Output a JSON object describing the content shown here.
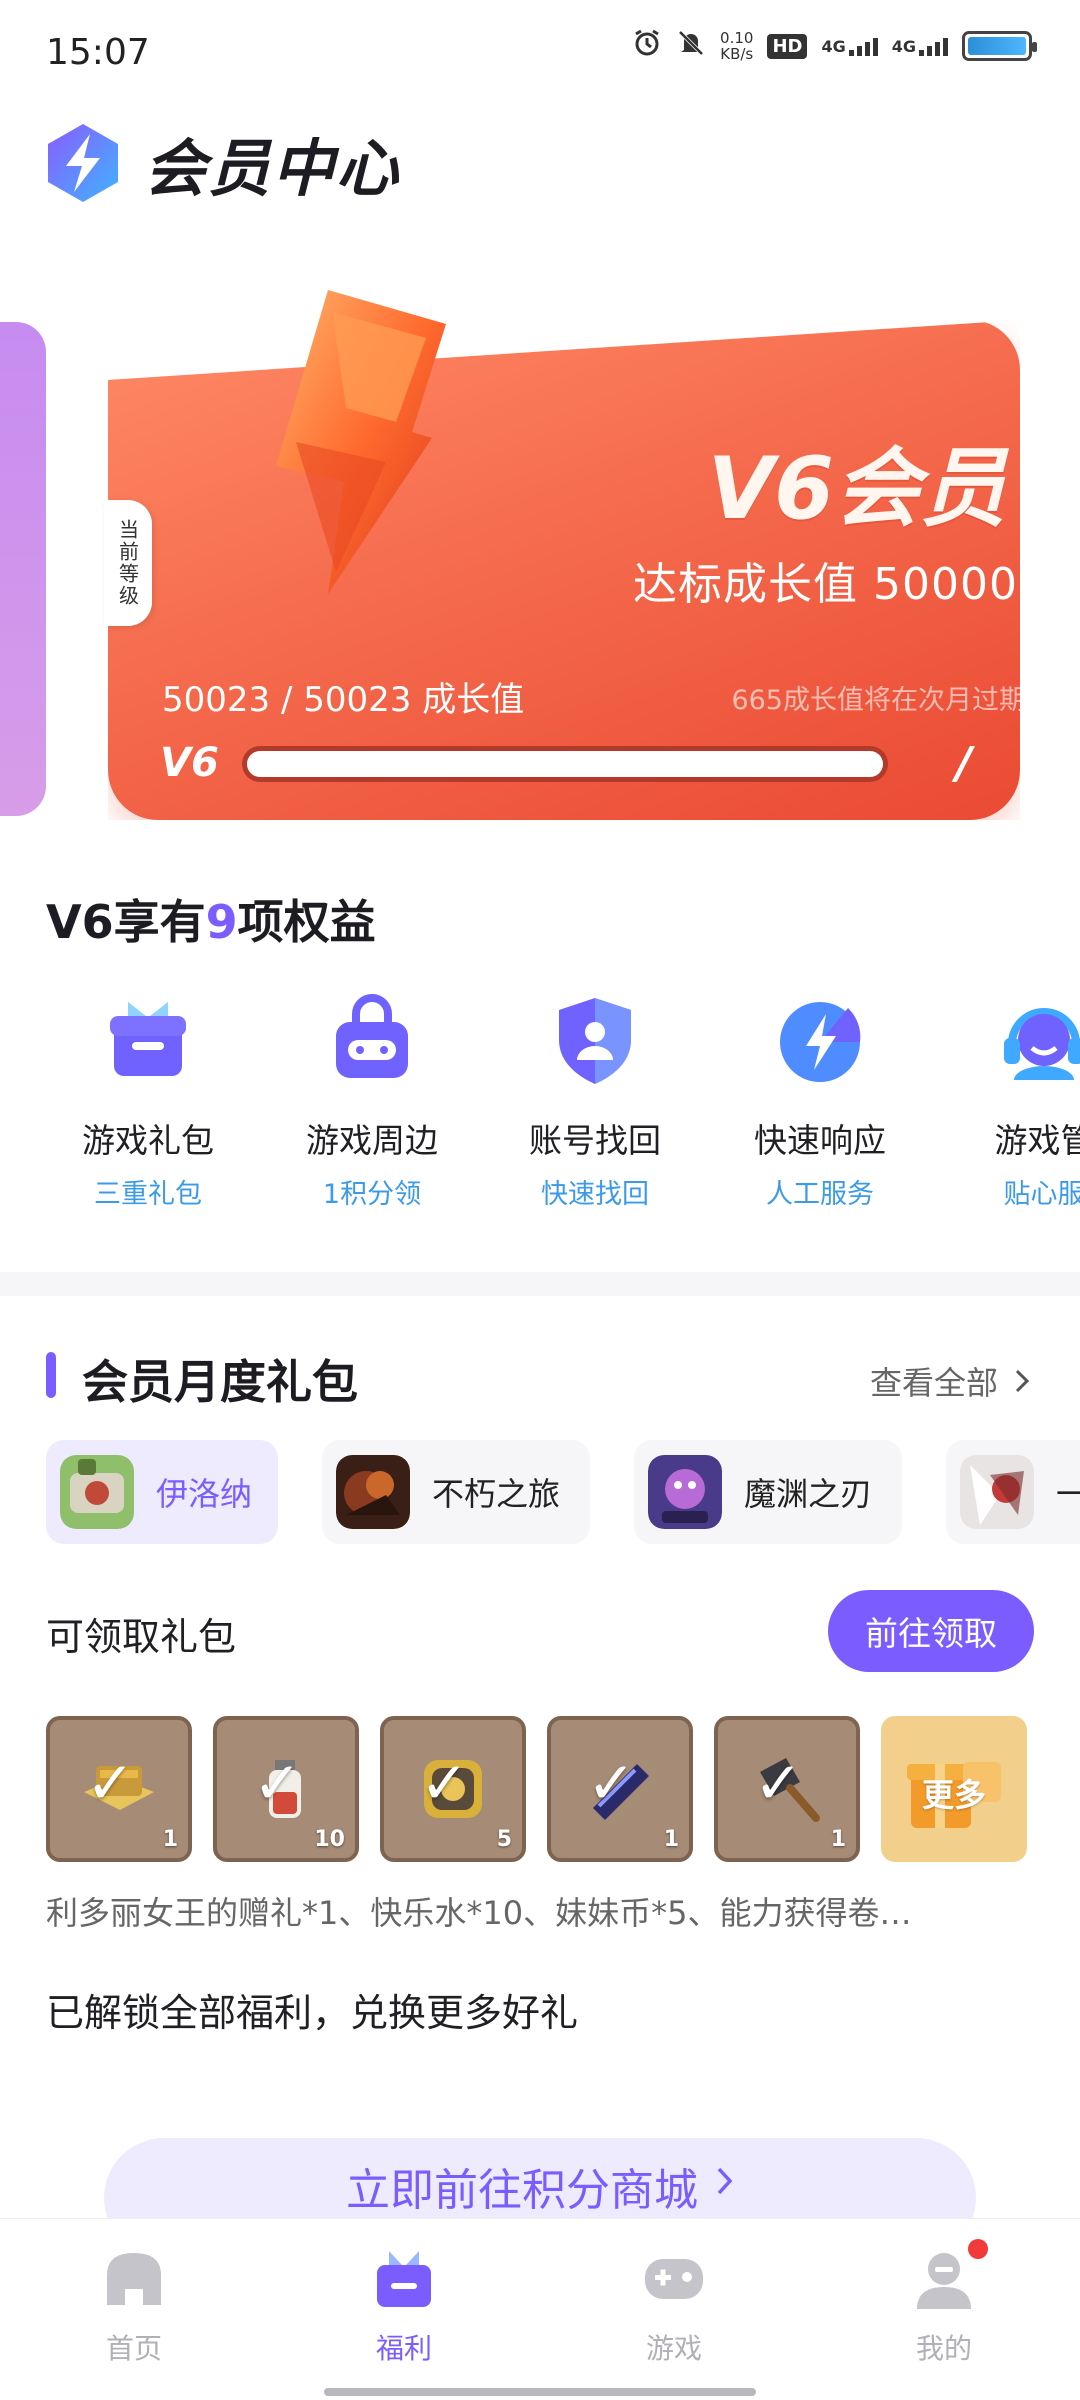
{
  "status_bar": {
    "time": "15:07",
    "speed_top": "0.10",
    "speed_bottom": "KB/s",
    "hd": "HD",
    "sim1": "4G",
    "sim2": "4G",
    "icons": [
      "alarm-icon",
      "mute-icon",
      "hd-icon",
      "signal-icon",
      "signal-icon",
      "battery-icon"
    ]
  },
  "header": {
    "title": "会员中心"
  },
  "member_card": {
    "level_tag": "当前等级",
    "level_name": "V6会员",
    "threshold": "达标成长值 50000",
    "progress_text": "50023 / 50023 成长值",
    "expire_note": "665成长值将在次月过期",
    "current_level": "V6",
    "next_level": "/",
    "progress": 1.0
  },
  "benefits": {
    "title_prefix": "V6享有",
    "count": "9",
    "title_suffix": "项权益",
    "items": [
      {
        "name": "游戏礼包",
        "sub": "三重礼包",
        "icon": "gift-box-icon"
      },
      {
        "name": "游戏周边",
        "sub": "1积分领",
        "icon": "gamepad-bag-icon"
      },
      {
        "name": "账号找回",
        "sub": "快速找回",
        "icon": "account-shield-icon"
      },
      {
        "name": "快速响应",
        "sub": "人工服务",
        "icon": "fast-response-icon"
      },
      {
        "name": "游戏管",
        "sub": "贴心服",
        "icon": "headset-icon"
      }
    ]
  },
  "monthly_gift": {
    "title": "会员月度礼包",
    "view_all": "查看全部",
    "games": [
      {
        "name": "伊洛纳",
        "active": true
      },
      {
        "name": "不朽之旅",
        "active": false
      },
      {
        "name": "魔渊之刃",
        "active": false
      },
      {
        "name": "一",
        "active": false
      }
    ],
    "claim_label": "可领取礼包",
    "claim_button": "前往领取",
    "items": [
      {
        "count": "1",
        "icon": "treasure-map-icon"
      },
      {
        "count": "10",
        "icon": "potion-bottle-icon"
      },
      {
        "count": "5",
        "icon": "coin-icon"
      },
      {
        "count": "1",
        "icon": "scroll-icon"
      },
      {
        "count": "1",
        "icon": "cleaver-icon"
      }
    ],
    "more_label": "更多",
    "description": "利多丽女王的赠礼*1、快乐水*10、妹妹币*5、能力获得卷…",
    "unlocked_text": "已解锁全部福利，兑换更多好礼",
    "shop_button": "立即前往积分商城"
  },
  "bottom_nav": [
    {
      "label": "首页",
      "icon": "home-icon",
      "active": false
    },
    {
      "label": "福利",
      "icon": "gift-icon",
      "active": true
    },
    {
      "label": "游戏",
      "icon": "gamepad-icon",
      "active": false
    },
    {
      "label": "我的",
      "icon": "profile-icon",
      "active": false
    }
  ],
  "colors": {
    "accent": "#7b5cff",
    "card_start": "#ff8a66",
    "card_end": "#ea4a33",
    "link_blue": "#3b9be8"
  }
}
